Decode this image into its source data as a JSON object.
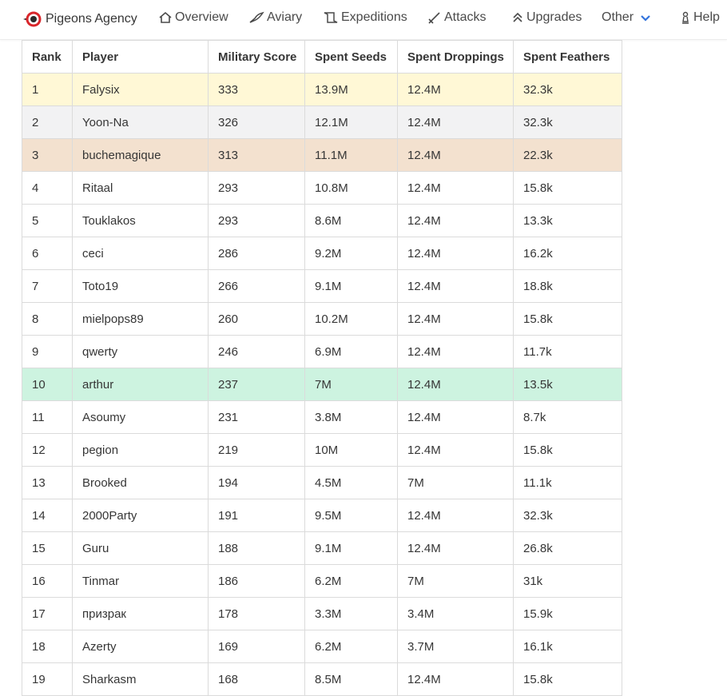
{
  "nav": {
    "brand": "Pigeons Agency",
    "items": [
      {
        "label": "Overview",
        "icon": "home-icon"
      },
      {
        "label": "Aviary",
        "icon": "bird-icon"
      },
      {
        "label": "Expeditions",
        "icon": "map-icon"
      },
      {
        "label": "Attacks",
        "icon": "sword-icon"
      },
      {
        "label": "Upgrades",
        "icon": "double-chevron-up-icon"
      },
      {
        "label": "Other",
        "icon": "chevron-down-icon"
      },
      {
        "label": "Help",
        "icon": "chess-pawn-icon"
      }
    ]
  },
  "table": {
    "headers": [
      "Rank",
      "Player",
      "Military Score",
      "Spent Seeds",
      "Spent Droppings",
      "Spent Feathers"
    ],
    "rows": [
      [
        "1",
        "Falysix",
        "333",
        "13.9M",
        "12.4M",
        "32.3k"
      ],
      [
        "2",
        "Yoon-Na",
        "326",
        "12.1M",
        "12.4M",
        "32.3k"
      ],
      [
        "3",
        "buchemagique",
        "313",
        "11.1M",
        "12.4M",
        "22.3k"
      ],
      [
        "4",
        "Ritaal",
        "293",
        "10.8M",
        "12.4M",
        "15.8k"
      ],
      [
        "5",
        "Touklakos",
        "293",
        "8.6M",
        "12.4M",
        "13.3k"
      ],
      [
        "6",
        "ceci",
        "286",
        "9.2M",
        "12.4M",
        "16.2k"
      ],
      [
        "7",
        "Toto19",
        "266",
        "9.1M",
        "12.4M",
        "18.8k"
      ],
      [
        "8",
        "mielpops89",
        "260",
        "10.2M",
        "12.4M",
        "15.8k"
      ],
      [
        "9",
        "qwerty",
        "246",
        "6.9M",
        "12.4M",
        "11.7k"
      ],
      [
        "10",
        "arthur",
        "237",
        "7M",
        "12.4M",
        "13.5k"
      ],
      [
        "11",
        "Asoumy",
        "231",
        "3.8M",
        "12.4M",
        "8.7k"
      ],
      [
        "12",
        "pegion",
        "219",
        "10M",
        "12.4M",
        "15.8k"
      ],
      [
        "13",
        "Brooked",
        "194",
        "4.5M",
        "7M",
        "11.1k"
      ],
      [
        "14",
        "2000Party",
        "191",
        "9.5M",
        "12.4M",
        "32.3k"
      ],
      [
        "15",
        "Guru",
        "188",
        "9.1M",
        "12.4M",
        "26.8k"
      ],
      [
        "16",
        "Tinmar",
        "186",
        "6.2M",
        "7M",
        "31k"
      ],
      [
        "17",
        "призрак",
        "178",
        "3.3M",
        "3.4M",
        "15.9k"
      ],
      [
        "18",
        "Azerty",
        "169",
        "6.2M",
        "3.7M",
        "16.1k"
      ],
      [
        "19",
        "Sharkasm",
        "168",
        "8.5M",
        "12.4M",
        "15.8k"
      ]
    ],
    "highlight": {
      "1": "gold",
      "2": "silver",
      "3": "bronze",
      "10": "me"
    },
    "colors": {
      "gold": "#fff8d6",
      "silver": "#f2f2f3",
      "bronze": "#f3e1cf",
      "me": "#cdf3e0",
      "accent": "#3273dc"
    }
  }
}
